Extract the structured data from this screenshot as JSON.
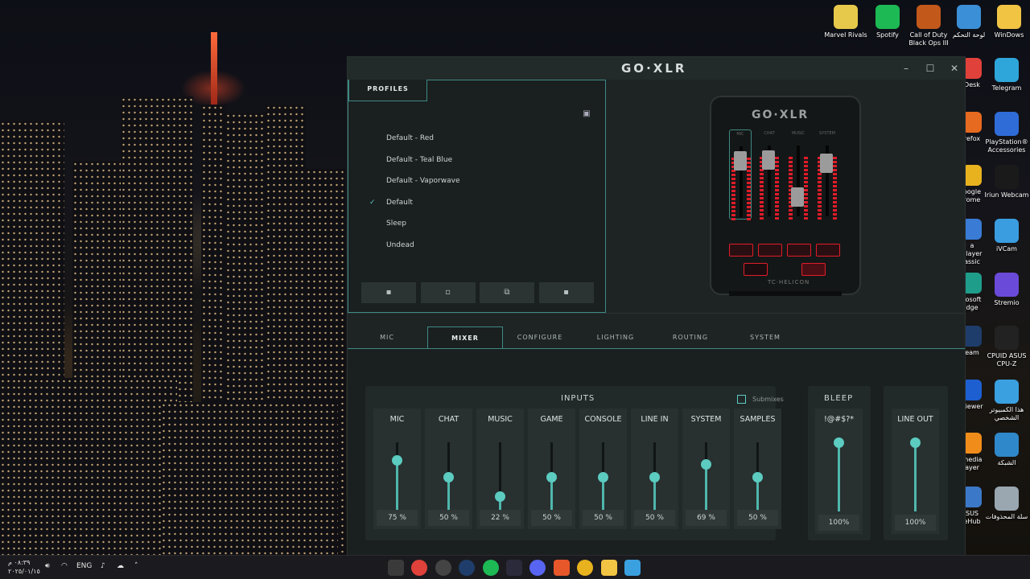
{
  "desktop_icons_right": [
    {
      "label": "Marvel Rivals",
      "icon": "marvel-rivals-icon",
      "color": "#e6c94a"
    },
    {
      "label": "Spotify",
      "icon": "spotify-icon",
      "color": "#1db954"
    },
    {
      "label": "Call of Duty Black Ops III",
      "icon": "call-of-duty-icon",
      "color": "#c2581a"
    },
    {
      "label": "لوحة التحكم",
      "icon": "control-panel-icon",
      "color": "#3b8fd6"
    },
    {
      "label": "WinDows",
      "icon": "folder-icon",
      "color": "#f2c444"
    }
  ],
  "desktop_icons_col": [
    {
      "label": "Telegram",
      "icon": "telegram-icon",
      "color": "#2ea6da"
    },
    {
      "label": "PlayStation® Accessories",
      "icon": "playstation-icon",
      "color": "#2f6cd8"
    },
    {
      "label": "Iriun Webcam",
      "icon": "webcam-icon",
      "color": "#1a1a1a"
    },
    {
      "label": "iVCam",
      "icon": "ivcam-icon",
      "color": "#3a9de0"
    },
    {
      "label": "Stremio",
      "icon": "stremio-icon",
      "color": "#6a4ad8"
    },
    {
      "label": "CPUID ASUS CPU-Z",
      "icon": "cpuz-icon",
      "color": "#222"
    },
    {
      "label": "هذا الكمبيوتر الشخصي",
      "icon": "this-pc-icon",
      "color": "#3aa0e0"
    },
    {
      "label": "الشبكة",
      "icon": "network-icon",
      "color": "#2f88c9"
    },
    {
      "label": "سلة المحذوفات",
      "icon": "recycle-bin-icon",
      "color": "#9aa6b0"
    }
  ],
  "desktop_icons_partial": [
    {
      "label": "Desk",
      "icon": "anydesk-icon",
      "color": "#e0413a"
    },
    {
      "label": "refox",
      "icon": "firefox-icon",
      "color": "#e66a1f"
    },
    {
      "label": "oogle rome",
      "icon": "chrome-icon",
      "color": "#e8b21f"
    },
    {
      "label": "a Player assic",
      "icon": "media-player-classic-icon",
      "color": "#3a7bd5"
    },
    {
      "label": "rosoft dge",
      "icon": "edge-icon",
      "color": "#1f9d8b"
    },
    {
      "label": "eam",
      "icon": "steam-icon",
      "color": "#1e3d6b"
    },
    {
      "label": "Viewer",
      "icon": "teamviewer-icon",
      "color": "#1d5fd0"
    },
    {
      "label": "media ayer",
      "icon": "vlc-icon",
      "color": "#f08c1a"
    },
    {
      "label": "SUS eHub",
      "icon": "asus-hub-icon",
      "color": "#3c78c8"
    }
  ],
  "window": {
    "logo": "GO·XLR",
    "minimize": "–",
    "maximize": "☐",
    "close": "✕"
  },
  "profiles": {
    "tab_label": "PROFILES",
    "items": [
      {
        "name": "Default - Red",
        "active": false
      },
      {
        "name": "Default - Teal Blue",
        "active": false
      },
      {
        "name": "Default - Vaporwave",
        "active": false
      },
      {
        "name": "Default",
        "active": true
      },
      {
        "name": "Sleep",
        "active": false
      },
      {
        "name": "Undead",
        "active": false
      }
    ],
    "check_glyph": "✓",
    "buttons": [
      "save-icon",
      "new-file-icon",
      "copy-icon",
      "delete-icon"
    ],
    "button_glyphs": [
      "▪",
      "▫",
      "⧉",
      "▪"
    ]
  },
  "device": {
    "logo": "GO·XLR",
    "brand": "TC·HELICON",
    "fader_labels": [
      "MIC",
      "CHAT",
      "MUSIC",
      "SYSTEM"
    ]
  },
  "tabs": [
    {
      "label": "MIC",
      "active": false
    },
    {
      "label": "MIXER",
      "active": true
    },
    {
      "label": "CONFIGURE",
      "active": false
    },
    {
      "label": "LIGHTING",
      "active": false
    },
    {
      "label": "ROUTING",
      "active": false
    },
    {
      "label": "SYSTEM",
      "active": false
    }
  ],
  "mixer": {
    "inputs_title": "INPUTS",
    "submixes_label": "Submixes",
    "channels": [
      {
        "label": "MIC",
        "value": 75,
        "display": "75 %"
      },
      {
        "label": "CHAT",
        "value": 50,
        "display": "50 %"
      },
      {
        "label": "MUSIC",
        "value": 22,
        "display": "22 %"
      },
      {
        "label": "GAME",
        "value": 50,
        "display": "50 %"
      },
      {
        "label": "CONSOLE",
        "value": 50,
        "display": "50 %"
      },
      {
        "label": "LINE IN",
        "value": 50,
        "display": "50 %"
      },
      {
        "label": "SYSTEM",
        "value": 69,
        "display": "69 %"
      },
      {
        "label": "SAMPLES",
        "value": 50,
        "display": "50 %"
      }
    ],
    "bleep": {
      "title": "BLEEP",
      "label": "!@#$?*",
      "value": 100,
      "display": "100%"
    },
    "outputs": {
      "label": "LINE OUT",
      "value": 100,
      "display": "100%"
    }
  },
  "taskbar": {
    "clock_time": "٠٨:٣٩ م",
    "clock_date": "٢٠٢٥/٠١/١٥",
    "lang": "ENG",
    "icons": [
      {
        "name": "xbox-icon",
        "color": "#3a3a3a"
      },
      {
        "name": "close-app-icon",
        "color": "#e0413a"
      },
      {
        "name": "chrome-alt-icon",
        "color": "#444"
      },
      {
        "name": "steam-icon",
        "color": "#1e3d6b"
      },
      {
        "name": "spotify-icon",
        "color": "#1db954"
      },
      {
        "name": "steam-alt-icon",
        "color": "#2a2a3a"
      },
      {
        "name": "discord-icon",
        "color": "#5865f2"
      },
      {
        "name": "brave-icon",
        "color": "#e8572a"
      },
      {
        "name": "chrome-icon",
        "color": "#e8b21f"
      },
      {
        "name": "file-explorer-icon",
        "color": "#f2c444"
      },
      {
        "name": "windows-store-icon",
        "color": "#3aa0e0"
      }
    ]
  },
  "colors": {
    "accent": "#5ccbc0",
    "panel": "#1a1f1f",
    "led": "#e01c2a"
  }
}
